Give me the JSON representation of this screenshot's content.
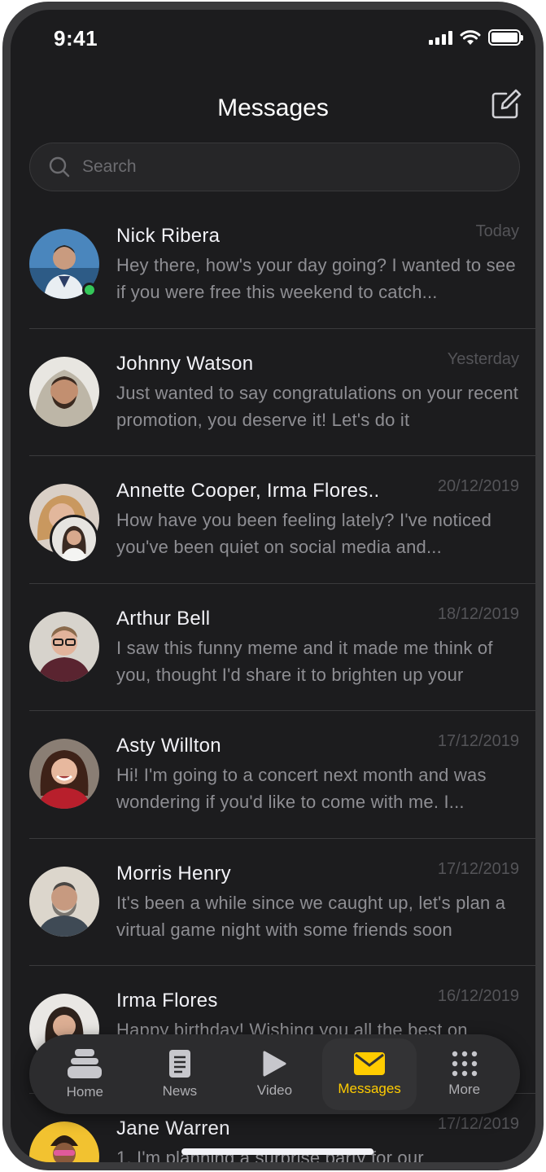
{
  "status_bar": {
    "time": "9:41"
  },
  "header": {
    "title": "Messages",
    "compose_icon": "compose-icon"
  },
  "search": {
    "placeholder": "Search"
  },
  "conversations": [
    {
      "name": "Nick Ribera",
      "date": "Today",
      "preview": "Hey there, how's your day going? I wanted to see if you were free this weekend to catch...",
      "online": true,
      "avatar_color": "#3b6f9f"
    },
    {
      "name": "Johnny Watson",
      "date": "Yesterday",
      "preview": "Just wanted to say congratulations on your recent promotion, you deserve it! Let's do it",
      "avatar_color": "#b9b3a6"
    },
    {
      "name": "Annette Cooper, Irma Flores..",
      "date": "20/12/2019",
      "preview": "How have you been feeling lately? I've noticed you've been quiet on social media and...",
      "group": true,
      "avatar_color": "#c9a48a"
    },
    {
      "name": "Arthur Bell",
      "date": "18/12/2019",
      "preview": "I saw this funny meme and it made me think of you, thought I'd share it to brighten up your",
      "avatar_color": "#5a2430"
    },
    {
      "name": "Asty Willton",
      "date": "17/12/2019",
      "preview": "Hi! I'm going to a concert next month and was wondering if you'd like to come with me. I...",
      "avatar_color": "#b81f2c"
    },
    {
      "name": "Morris Henry",
      "date": "17/12/2019",
      "preview": "It's been a while since we caught up, let's plan a virtual game night with some friends soon",
      "avatar_color": "#6b6e70"
    },
    {
      "name": "Irma Flores",
      "date": "16/12/2019",
      "preview": "Happy birthday! Wishing you all the best on",
      "avatar_color": "#d8d4cf"
    },
    {
      "name": "Jane Warren",
      "date": "17/12/2019",
      "preview": "1. I'm planning a surprise party for our",
      "avatar_color": "#f2c230"
    }
  ],
  "tabs": [
    {
      "label": "Home",
      "icon": "home-icon"
    },
    {
      "label": "News",
      "icon": "news-icon"
    },
    {
      "label": "Video",
      "icon": "video-icon"
    },
    {
      "label": "Messages",
      "icon": "mail-icon",
      "active": true
    },
    {
      "label": "More",
      "icon": "grid-icon"
    }
  ],
  "colors": {
    "accent": "#ffcc00",
    "background": "#1c1c1e",
    "online": "#34c759"
  }
}
